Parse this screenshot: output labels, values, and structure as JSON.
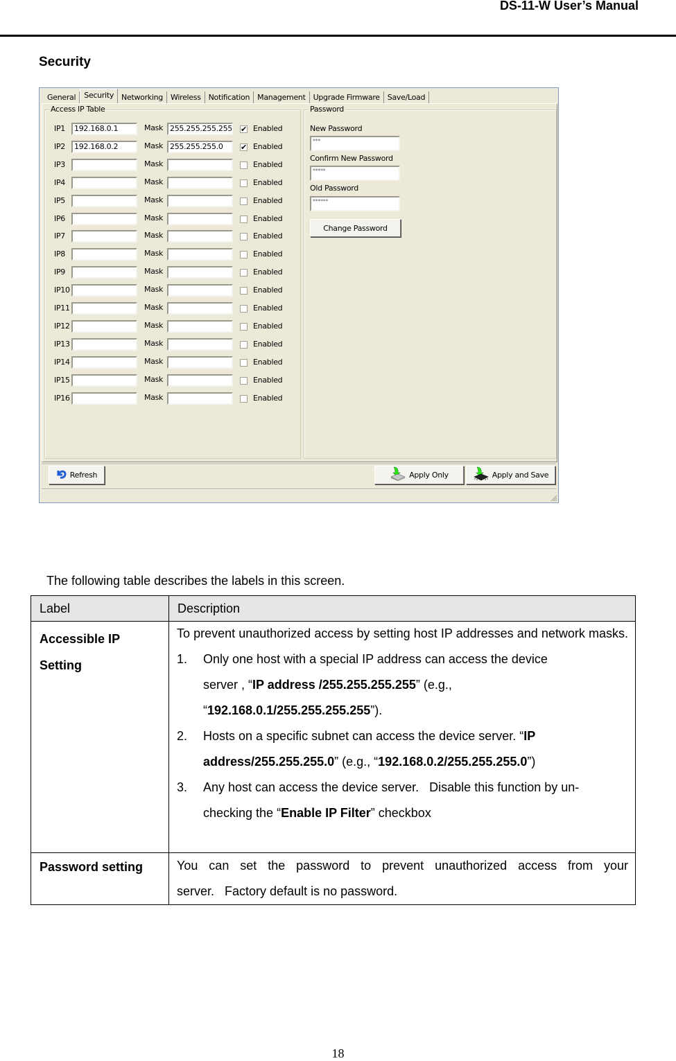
{
  "header": {
    "title": "DS-11-W User’s Manual"
  },
  "section_title": "Security",
  "screenshot": {
    "tabs": [
      {
        "label": "General",
        "active": false
      },
      {
        "label": "Security",
        "active": true
      },
      {
        "label": "Networking",
        "active": false
      },
      {
        "label": "Wireless",
        "active": false
      },
      {
        "label": "Notification",
        "active": false
      },
      {
        "label": "Management",
        "active": false
      },
      {
        "label": "Upgrade Firmware",
        "active": false
      },
      {
        "label": "Save/Load",
        "active": false
      }
    ],
    "access_ip_table": {
      "title": "Access IP Table",
      "mask_label": "Mask",
      "enabled_label": "Enabled",
      "rows": [
        {
          "label": "IP1",
          "ip": "192.168.0.1",
          "mask": "255.255.255.255",
          "enabled": true
        },
        {
          "label": "IP2",
          "ip": "192.168.0.2",
          "mask": "255.255.255.0",
          "enabled": true
        },
        {
          "label": "IP3",
          "ip": "",
          "mask": "",
          "enabled": false
        },
        {
          "label": "IP4",
          "ip": "",
          "mask": "",
          "enabled": false
        },
        {
          "label": "IP5",
          "ip": "",
          "mask": "",
          "enabled": false
        },
        {
          "label": "IP6",
          "ip": "",
          "mask": "",
          "enabled": false
        },
        {
          "label": "IP7",
          "ip": "",
          "mask": "",
          "enabled": false
        },
        {
          "label": "IP8",
          "ip": "",
          "mask": "",
          "enabled": false
        },
        {
          "label": "IP9",
          "ip": "",
          "mask": "",
          "enabled": false
        },
        {
          "label": "IP10",
          "ip": "",
          "mask": "",
          "enabled": false
        },
        {
          "label": "IP11",
          "ip": "",
          "mask": "",
          "enabled": false
        },
        {
          "label": "IP12",
          "ip": "",
          "mask": "",
          "enabled": false
        },
        {
          "label": "IP13",
          "ip": "",
          "mask": "",
          "enabled": false
        },
        {
          "label": "IP14",
          "ip": "",
          "mask": "",
          "enabled": false
        },
        {
          "label": "IP15",
          "ip": "",
          "mask": "",
          "enabled": false
        },
        {
          "label": "IP16",
          "ip": "",
          "mask": "",
          "enabled": false
        }
      ]
    },
    "password": {
      "title": "Password",
      "new_label": "New Password",
      "new_value": "***",
      "confirm_label": "Confirm New Password",
      "confirm_value": "*****",
      "old_label": "Old Password",
      "old_value": "******",
      "change_button": "Change Password"
    },
    "buttons": {
      "refresh": "Refresh",
      "apply_only": "Apply Only",
      "apply_save": "Apply and Save"
    }
  },
  "intro_text": "The following table describes the labels in this screen.",
  "table": {
    "headers": [
      "Label",
      "Description"
    ],
    "rows": [
      {
        "label": "Accessible IP Setting",
        "intro": "To prevent unauthorized access by setting host IP addresses and network masks.",
        "items": [
          {
            "num": "1.",
            "pre": "Only one host with a special IP address can access the device server , “",
            "bold": "IP address /255.255.255.255",
            "mid": "” (e.g., “",
            "bold2": "192.168.0.1/255.255.255.255",
            "post": "”)."
          },
          {
            "num": "2.",
            "pre": "Hosts on a specific subnet can access the device server. “",
            "bold": "IP address/255.255.255.0",
            "mid": "” (e.g., “",
            "bold2": "192.168.0.2/255.255.255.0",
            "post": "”)"
          },
          {
            "num": "3.",
            "pre": "Any host can access the device server.   Disable this function by un-checking the “",
            "bold": "Enable IP Filter",
            "mid": "” checkbox",
            "bold2": "",
            "post": ""
          }
        ]
      },
      {
        "label": "Password setting",
        "description": "You can set the password to prevent unauthorized access from your server.   Factory default is no password."
      }
    ]
  },
  "page_number": "18"
}
